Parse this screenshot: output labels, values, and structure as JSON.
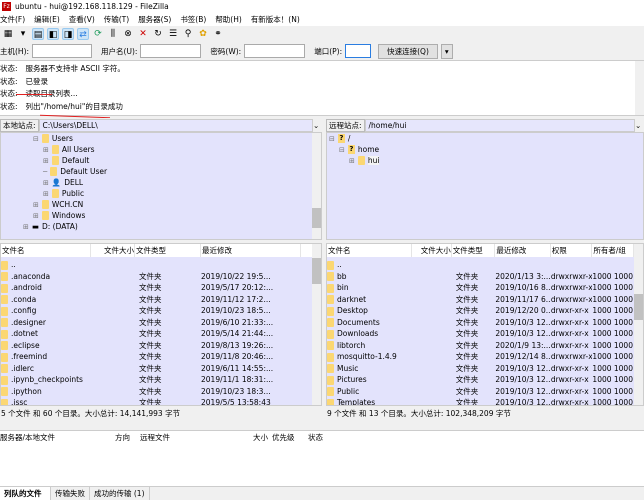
{
  "title": "ubuntu - hui@192.168.118.129 - FileZilla",
  "menu": [
    "文件(F)",
    "编辑(E)",
    "查看(V)",
    "传输(T)",
    "服务器(S)",
    "书签(B)",
    "帮助(H)",
    "有新版本！(N)"
  ],
  "quickconnect": {
    "host_label": "主机(H):",
    "user_label": "用户名(U):",
    "pass_label": "密码(W):",
    "port_label": "端口(P):",
    "connect_button": "快速连接(Q)",
    "host": "",
    "user": "",
    "pass": "",
    "port": ""
  },
  "log": [
    {
      "k": "状态:",
      "v": "服务器不支持非 ASCII 字符。"
    },
    {
      "k": "状态:",
      "v": "已登录"
    },
    {
      "k": "状态:",
      "v": "读取目录列表..."
    },
    {
      "k": "状态:",
      "v": "列出\"/home/hui\"的目录成功"
    }
  ],
  "local": {
    "label": "本地站点:",
    "path": "C:\\Users\\DELL\\",
    "tree": [
      "Users",
      "All Users",
      "Default",
      "Default User",
      "DELL",
      "Public",
      "WCH.CN",
      "Windows",
      "D: (DATA)"
    ],
    "headers": [
      "文件名",
      "文件大小",
      "文件类型",
      "最近修改"
    ],
    "rows": [
      [
        "..",
        "",
        "",
        ""
      ],
      [
        ".anaconda",
        "",
        "文件夹",
        "2019/10/22 19:5..."
      ],
      [
        ".android",
        "",
        "文件夹",
        "2019/5/17 20:12:..."
      ],
      [
        ".conda",
        "",
        "文件夹",
        "2019/11/12 17:2..."
      ],
      [
        ".config",
        "",
        "文件夹",
        "2019/10/23 18:5..."
      ],
      [
        ".designer",
        "",
        "文件夹",
        "2019/6/10 21:33:..."
      ],
      [
        ".dotnet",
        "",
        "文件夹",
        "2019/5/14 21:44:..."
      ],
      [
        ".eclipse",
        "",
        "文件夹",
        "2019/8/13 19:26:..."
      ],
      [
        ".freemind",
        "",
        "文件夹",
        "2019/11/8 20:46:..."
      ],
      [
        ".idlerc",
        "",
        "文件夹",
        "2019/6/11 14:55:..."
      ],
      [
        ".ipynb_checkpoints",
        "",
        "文件夹",
        "2019/11/1 18:31:..."
      ],
      [
        ".ipython",
        "",
        "文件夹",
        "2019/10/23 18:3..."
      ],
      [
        ".jssc",
        "",
        "文件夹",
        "2019/5/5 13:58:43"
      ]
    ],
    "status": "5 个文件 和 60 个目录。大小总计: 14,141,993 字节"
  },
  "remote": {
    "label": "远程站点:",
    "path": "/home/hui",
    "tree": [
      "/",
      "home",
      "hui"
    ],
    "headers": [
      "文件名",
      "文件大小",
      "文件类型",
      "最近修改",
      "权限",
      "所有者/组"
    ],
    "rows": [
      [
        "..",
        "",
        "",
        "",
        "",
        ""
      ],
      [
        "bb",
        "",
        "文件夹",
        "2020/1/13 3:...",
        "drwxrwxr-x",
        "1000 1000"
      ],
      [
        "bin",
        "",
        "文件夹",
        "2019/10/16 8...",
        "drwxrwxr-x",
        "1000 1000"
      ],
      [
        "darknet",
        "",
        "文件夹",
        "2019/11/17 6...",
        "drwxrwxr-x",
        "1000 1000"
      ],
      [
        "Desktop",
        "",
        "文件夹",
        "2019/12/20 0...",
        "drwxr-xr-x",
        "1000 1000"
      ],
      [
        "Documents",
        "",
        "文件夹",
        "2019/10/3 12...",
        "drwxr-xr-x",
        "1000 1000"
      ],
      [
        "Downloads",
        "",
        "文件夹",
        "2019/10/3 12...",
        "drwxr-xr-x",
        "1000 1000"
      ],
      [
        "libtorch",
        "",
        "文件夹",
        "2020/1/9 13:...",
        "drwxr-xr-x",
        "1000 1000"
      ],
      [
        "mosquitto-1.4.9",
        "",
        "文件夹",
        "2019/12/14 8...",
        "drwxrwxr-x",
        "1000 1000"
      ],
      [
        "Music",
        "",
        "文件夹",
        "2019/10/3 12...",
        "drwxr-xr-x",
        "1000 1000"
      ],
      [
        "Pictures",
        "",
        "文件夹",
        "2019/10/3 12...",
        "drwxr-xr-x",
        "1000 1000"
      ],
      [
        "Public",
        "",
        "文件夹",
        "2019/10/3 12...",
        "drwxr-xr-x",
        "1000 1000"
      ],
      [
        "Templates",
        "",
        "文件夹",
        "2019/10/3 12...",
        "drwxr-xr-x",
        "1000 1000"
      ]
    ],
    "status": "9 个文件 和 13 个目录。大小总计: 102,348,209 字节"
  },
  "queue": {
    "headers": [
      "服务器/本地文件",
      "方向",
      "远程文件",
      "大小",
      "优先级",
      "状态"
    ]
  },
  "tabs": [
    "列队的文件",
    "传输失败",
    "成功的传输 (1)"
  ]
}
